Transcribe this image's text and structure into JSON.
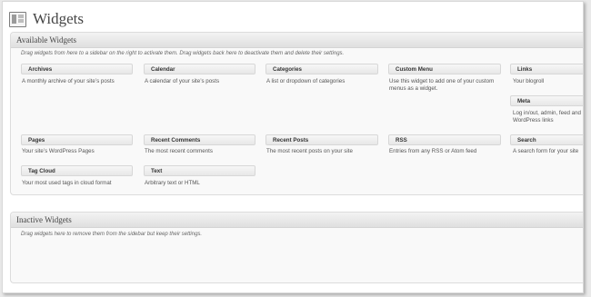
{
  "page": {
    "title": "Widgets",
    "icon": "widgets-icon"
  },
  "available": {
    "heading": "Available Widgets",
    "description": "Drag widgets from here to a sidebar on the right to activate them. Drag widgets back here to deactivate them and delete their settings.",
    "widgets": [
      {
        "name": "Archives",
        "desc": "A monthly archive of your site’s posts"
      },
      {
        "name": "Calendar",
        "desc": "A calendar of your site’s posts"
      },
      {
        "name": "Categories",
        "desc": "A list or dropdown of categories"
      },
      {
        "name": "Custom Menu",
        "desc": "Use this widget to add one of your custom menus as a widget."
      },
      {
        "name": "Links",
        "desc": "Your blogroll"
      },
      {
        "name": "Meta",
        "desc": "Log in/out, admin, feed and WordPress links"
      },
      {
        "name": "Pages",
        "desc": "Your site’s WordPress Pages"
      },
      {
        "name": "Recent Comments",
        "desc": "The most recent comments"
      },
      {
        "name": "Recent Posts",
        "desc": "The most recent posts on your site"
      },
      {
        "name": "RSS",
        "desc": "Entries from any RSS or Atom feed"
      },
      {
        "name": "Search",
        "desc": "A search form for your site"
      },
      {
        "name": "Tag Cloud",
        "desc": "Your most used tags in cloud format"
      },
      {
        "name": "Text",
        "desc": "Arbitrary text or HTML"
      }
    ]
  },
  "inactive": {
    "heading": "Inactive Widgets",
    "description": "Drag widgets here to remove them from the sidebar but keep their settings."
  }
}
